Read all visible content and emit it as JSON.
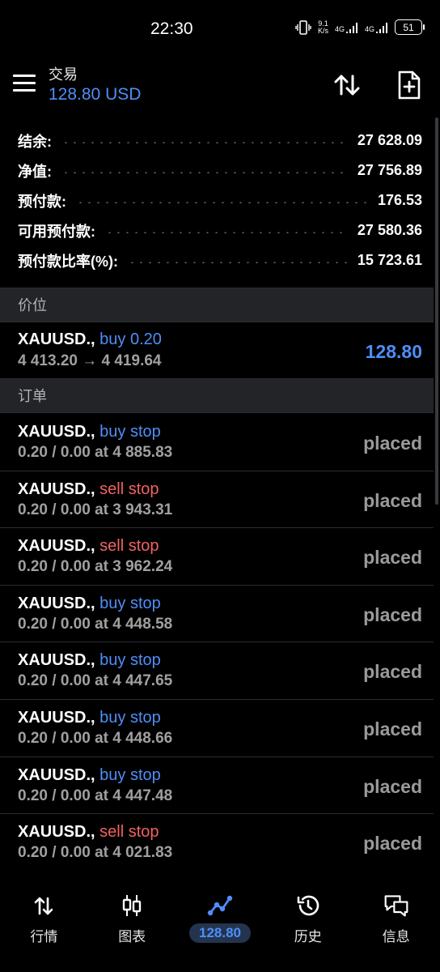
{
  "status_bar": {
    "time": "22:30",
    "net_speed_top": "9.1",
    "net_speed_bottom": "K/s",
    "signal1": "4G",
    "signal2": "4G",
    "battery": "51"
  },
  "header": {
    "title": "交易",
    "subtitle": "128.80 USD"
  },
  "summary": [
    {
      "label": "结余:",
      "value": "27 628.09"
    },
    {
      "label": "净值:",
      "value": "27 756.89"
    },
    {
      "label": "预付款:",
      "value": "176.53"
    },
    {
      "label": "可用预付款:",
      "value": "27 580.36"
    },
    {
      "label": "预付款比率(%):",
      "value": "15 723.61"
    }
  ],
  "positions_section": {
    "title": "价位"
  },
  "position": {
    "symbol": "XAUUSD.,",
    "side": "buy 0.20",
    "prices": "4 413.20 → 4 419.64",
    "profit": "128.80"
  },
  "orders_section": {
    "title": "订单"
  },
  "orders": [
    {
      "symbol": "XAUUSD.,",
      "side": "buy stop",
      "type": "buy",
      "detail": "0.20 / 0.00 at 4 885.83",
      "status": "placed"
    },
    {
      "symbol": "XAUUSD.,",
      "side": "sell stop",
      "type": "sell",
      "detail": "0.20 / 0.00 at 3 943.31",
      "status": "placed"
    },
    {
      "symbol": "XAUUSD.,",
      "side": "sell stop",
      "type": "sell",
      "detail": "0.20 / 0.00 at 3 962.24",
      "status": "placed"
    },
    {
      "symbol": "XAUUSD.,",
      "side": "buy stop",
      "type": "buy",
      "detail": "0.20 / 0.00 at 4 448.58",
      "status": "placed"
    },
    {
      "symbol": "XAUUSD.,",
      "side": "buy stop",
      "type": "buy",
      "detail": "0.20 / 0.00 at 4 447.65",
      "status": "placed"
    },
    {
      "symbol": "XAUUSD.,",
      "side": "buy stop",
      "type": "buy",
      "detail": "0.20 / 0.00 at 4 448.66",
      "status": "placed"
    },
    {
      "symbol": "XAUUSD.,",
      "side": "buy stop",
      "type": "buy",
      "detail": "0.20 / 0.00 at 4 447.48",
      "status": "placed"
    },
    {
      "symbol": "XAUUSD.,",
      "side": "sell stop",
      "type": "sell",
      "detail": "0.20 / 0.00 at 4 021.83",
      "status": "placed"
    }
  ],
  "bottom_nav": {
    "quotes": "行情",
    "charts": "图表",
    "trade": "128.80",
    "history": "历史",
    "messages": "信息"
  },
  "colors": {
    "accent": "#4f8ef7",
    "sell": "#f06262",
    "background": "#000000",
    "section_bg": "#232428"
  },
  "icons": {
    "menu": "menu-icon",
    "sort": "sort-icon",
    "new_order": "new-order-icon",
    "quotes": "quotes-icon",
    "charts": "candlestick-icon",
    "trade": "trade-icon",
    "history": "history-icon",
    "messages": "messages-icon"
  }
}
